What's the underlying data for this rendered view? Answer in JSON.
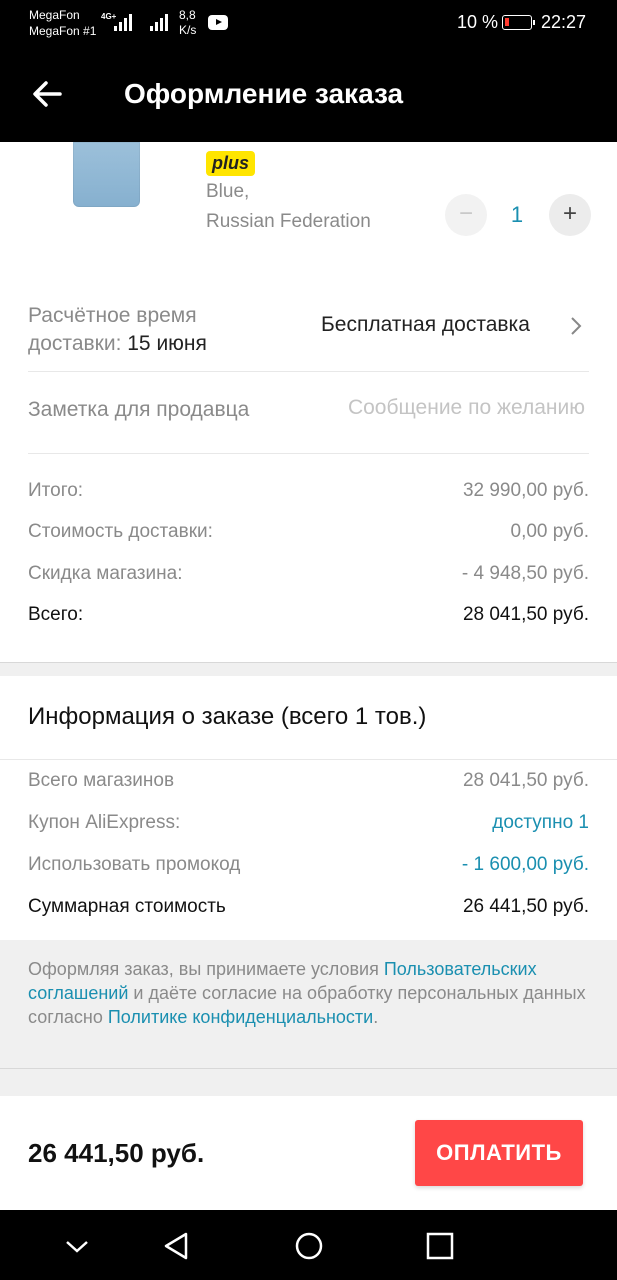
{
  "status_bar": {
    "carrier1": "MegaFon",
    "carrier2": "MegaFon #1",
    "network": "4G+",
    "speed_value": "8,8",
    "speed_unit": "K/s",
    "battery": "10 %",
    "time": "22:27"
  },
  "header": {
    "title": "Оформление заказа",
    "back_icon": "arrow-left-icon"
  },
  "product": {
    "badge": "plus",
    "color": "Blue,",
    "ship_from": "Russian Federation",
    "quantity": "1",
    "minus_label": "−",
    "plus_label": "+"
  },
  "delivery": {
    "label_line1": "Расчётное время",
    "label_line2": "доставки:",
    "date": "15 июня",
    "option": "Бесплатная доставка"
  },
  "seller_note": {
    "label": "Заметка для продавца",
    "placeholder": "Сообщение по желанию"
  },
  "summary": {
    "subtotal_label": "Итого:",
    "subtotal_value": "32 990,00 руб.",
    "shipping_label": "Стоимость доставки:",
    "shipping_value": "0,00 руб.",
    "discount_label": "Скидка магазина:",
    "discount_value": "- 4 948,50 руб.",
    "total_label": "Всего:",
    "total_value": "28 041,50 руб."
  },
  "order_info": {
    "title": "Информация о заказе (всего 1 тов.)",
    "stores_label": "Всего магазинов",
    "stores_value": "28 041,50 руб.",
    "coupon_label": "Купон AliExpress:",
    "coupon_value": "доступно 1",
    "promo_label": "Использовать промокод",
    "promo_value": "- 1 600,00 руб.",
    "grand_label": "Суммарная стоимость",
    "grand_value": "26 441,50 руб."
  },
  "terms": {
    "part1": "Оформляя заказ, вы принимаете условия ",
    "link1": "Пользовательских соглашений",
    "part2": " и даёте согласие на обработку персональных данных согласно ",
    "link2": "Политике конфиденциальности",
    "part3": "."
  },
  "checkout": {
    "total": "26 441,50 руб.",
    "pay_label": "ОПЛАТИТЬ"
  },
  "colors": {
    "accent": "#1a8fb0",
    "pay_button": "#ff4747",
    "badge": "#ffe500"
  }
}
